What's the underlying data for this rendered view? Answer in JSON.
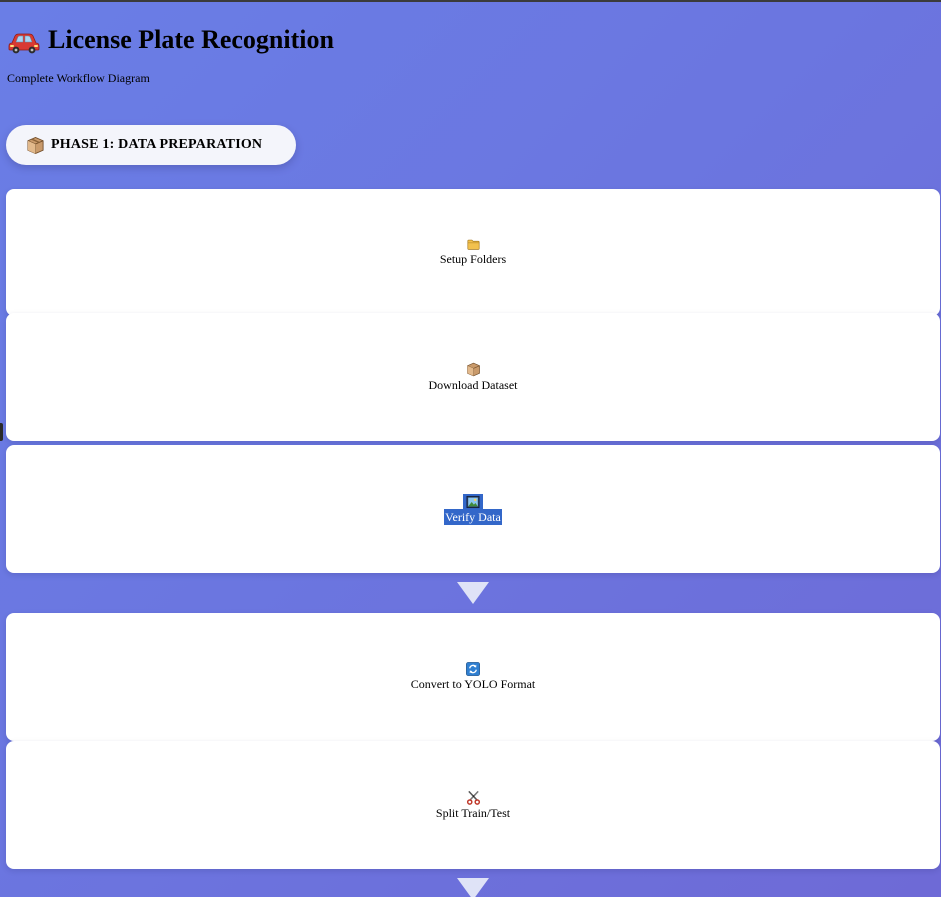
{
  "header": {
    "title": "License Plate Recognition",
    "subtitle": "Complete Workflow Diagram",
    "title_icon": "car-icon"
  },
  "phase": {
    "label": "PHASE 1: DATA PREPARATION",
    "icon": "package-icon"
  },
  "steps": [
    {
      "label": "Setup Folders",
      "icon": "folder-icon",
      "selected": false
    },
    {
      "label": "Download Dataset",
      "icon": "package-icon",
      "selected": false
    },
    {
      "label": "Verify Data",
      "icon": "picture-icon",
      "selected": true
    },
    {
      "label": "Convert to YOLO Format",
      "icon": "refresh-icon",
      "selected": false
    },
    {
      "label": "Split Train/Test",
      "icon": "scissors-icon",
      "selected": false
    }
  ],
  "colors": {
    "background": "#6b76e0",
    "card": "#ffffff",
    "selection": "#3367c9",
    "arrow": "#dfe3f7"
  }
}
